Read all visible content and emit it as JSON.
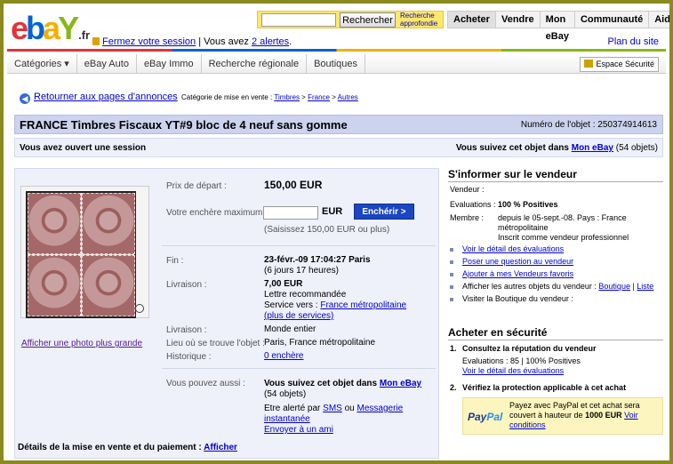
{
  "header": {
    "logo": {
      "e": "e",
      "b": "b",
      "a": "a",
      "y": "Y",
      "suffix": ".fr"
    },
    "search_button": "Rechercher",
    "advanced_search_line1": "Recherche",
    "advanced_search_line2": "approfondie",
    "nav": [
      "Acheter",
      "Vendre",
      "Mon eBay",
      "Communauté",
      "Aide"
    ],
    "close_session": "Fermez votre session",
    "alerts_prefix": " | Vous avez ",
    "alerts_link": "2 alertes",
    "alerts_suffix": ".",
    "site_map": "Plan du site",
    "categories": [
      "Catégories ▾",
      "eBay Auto",
      "eBay Immo",
      "Recherche régionale",
      "Boutiques"
    ],
    "secure_space": "Espace Sécurité"
  },
  "breadcrumb": {
    "back": "Retourner aux pages d'annonces",
    "label": "Catégorie de mise en vente : ",
    "path": [
      "Timbres",
      "France",
      "Autres"
    ],
    "sep": " > "
  },
  "item": {
    "title": "FRANCE Timbres Fiscaux YT#9 bloc de 4 neuf sans gomme",
    "number": "Numéro de l'objet : 250374914613",
    "session_opened": "Vous avez ouvert une session",
    "watching_prefix": "Vous suivez cet objet dans ",
    "watching_link": "Mon eBay",
    "watching_count": " (54 objets)",
    "photo_link": "Afficher une photo plus grande",
    "start_price_label": "Prix de départ :",
    "start_price": "150,00 EUR",
    "max_bid_label": "Votre enchère maximum :",
    "currency": "EUR",
    "bid_button": "Enchérir >",
    "bid_hint": "(Saisissez 150,00 EUR ou plus)",
    "end_label": "Fin :",
    "end_date": "23-févr.-09 17:04:27 Paris",
    "end_remaining": "(6 jours 17 heures)",
    "shipping_label": "Livraison :",
    "shipping_cost": "7,00 EUR",
    "shipping_method": "Lettre recommandée",
    "shipping_service_prefix": "Service vers : ",
    "shipping_service_link": "France métropolitaine",
    "more_services": "(plus de services)",
    "delivery_label": "Livraison :",
    "delivery_value": "Monde entier",
    "location_label": "Lieu où se trouve l'objet :",
    "location_value": "Paris, France métropolitaine",
    "history_label": "Historique :",
    "history_value": "0 enchère",
    "can_also_label": "Vous pouvez aussi :",
    "follow_prefix": "Vous suivez cet objet dans ",
    "follow_link": "Mon eBay",
    "follow_count": "(54 objets)",
    "alert_prefix": "Etre alerté par ",
    "alert_sms": "SMS",
    "alert_or": " ou ",
    "alert_msg_1": "Messagerie",
    "alert_msg_2": "instantanée",
    "send_friend": "Envoyer à un ami",
    "details_label": "Détails de la mise en vente et du paiement :",
    "details_link": "Afficher"
  },
  "seller": {
    "heading": "S'informer sur le vendeur",
    "seller_label": "Vendeur :",
    "eval_label": "Evaluations :",
    "eval_value": "100 % Positives",
    "member_label": "Membre :",
    "member_line1": "depuis le 05-sept.-08. Pays : France",
    "member_line2": "métropolitaine",
    "member_line3": "Inscrit comme vendeur professionnel",
    "links": [
      "Voir le détail des évaluations",
      "Poser une question au vendeur",
      "Ajouter à mes Vendeurs favoris"
    ],
    "other_items_prefix": "Afficher les autres objets du vendeur : ",
    "other_boutique": "Boutique",
    "other_sep": " | ",
    "other_liste": "Liste",
    "visit_shop": "Visiter la Boutique du vendeur :"
  },
  "secure": {
    "heading": "Acheter en sécurité",
    "step1_num": "1.",
    "step1_title": "Consultez la réputation du vendeur",
    "step1_line": "Evaluations : 85 | 100% Positives",
    "step1_link": "Voir le détail des évaluations",
    "step2_num": "2.",
    "step2_title": "Vérifiez la protection applicable à cet achat",
    "paypal_logo_a": "Pay",
    "paypal_logo_b": "Pal",
    "paypal_text_1": "Payez avec PayPal et cet achat sera couvert à hauteur de ",
    "paypal_amount": "1000 EUR",
    "paypal_text_2": " ",
    "paypal_link": "Voir conditions"
  },
  "colors": {
    "accent_blue": "#0000cc",
    "bid_button": "#1b46c1",
    "title_bar": "#ccd3ee",
    "paypal_bg": "#fcf5bf"
  }
}
